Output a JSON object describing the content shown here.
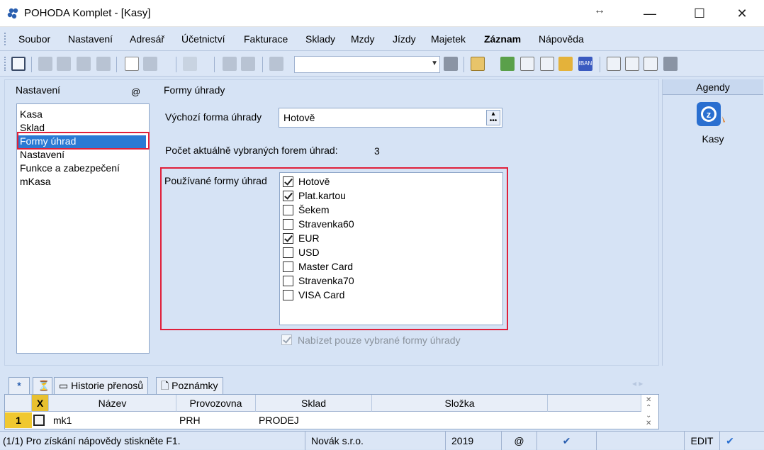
{
  "window": {
    "title": "POHODA Komplet - [Kasy]"
  },
  "menu": [
    "Soubor",
    "Nastavení",
    "Adresář",
    "Účetnictví",
    "Fakturace",
    "Sklady",
    "Mzdy",
    "Jízdy",
    "Majetek",
    "Záznam",
    "Nápověda"
  ],
  "nav": {
    "header": "Nastavení",
    "at": "@",
    "items": [
      "Kasa",
      "Sklad",
      "Formy úhrad",
      "Nastavení",
      "Funkce a zabezpečení",
      "mKasa"
    ],
    "selected": "Formy úhrad"
  },
  "form": {
    "section_title": "Formy úhrady",
    "default_label": "Výchozí forma úhrady",
    "default_value": "Hotově",
    "count_label": "Počet aktuálně vybraných forem úhrad:",
    "count_value": "3",
    "used_label": "Používané formy úhrad",
    "payment_methods": [
      {
        "label": "Hotově",
        "checked": true
      },
      {
        "label": "Plat.kartou",
        "checked": true
      },
      {
        "label": "Šekem",
        "checked": false
      },
      {
        "label": "Stravenka60",
        "checked": false
      },
      {
        "label": "EUR",
        "checked": true
      },
      {
        "label": "USD",
        "checked": false
      },
      {
        "label": "Master Card",
        "checked": false
      },
      {
        "label": "Stravenka70",
        "checked": false
      },
      {
        "label": "VISA Card",
        "checked": false
      }
    ],
    "offer_only_label": "Nabízet pouze vybrané formy úhrady"
  },
  "agenda": {
    "header": "Agendy",
    "item": "Kasy"
  },
  "tabs": {
    "star": "*",
    "history": "Historie přenosů",
    "notes": "Poznámky"
  },
  "grid": {
    "headers": [
      "X",
      "Název",
      "Provozovna",
      "Sklad",
      "Složka"
    ],
    "row": {
      "num": "1",
      "nazev": "mk1",
      "provozovna": "PRH",
      "sklad": "PRODEJ"
    }
  },
  "status": {
    "help": "(1/1) Pro získání nápovědy stiskněte F1.",
    "company": "Novák s.r.o.",
    "year": "2019",
    "at": "@",
    "mode": "EDIT"
  },
  "colors": {
    "selection": "#2a7ad4",
    "highlight_border": "#e0203a",
    "background": "#d6e3f5"
  }
}
